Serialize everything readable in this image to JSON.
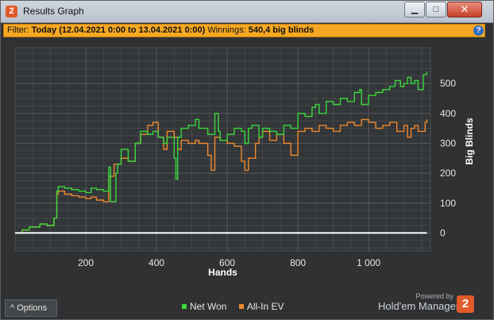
{
  "window": {
    "title": "Results Graph",
    "app_icon_label": "2"
  },
  "filter": {
    "prefix": "Filter:",
    "period": "Today (12.04.2021 0:00 to 13.04.2021 0:00)",
    "winnings_label": "Winnings:",
    "winnings_value": "540,4 big blinds",
    "help_label": "?"
  },
  "chart_data": {
    "type": "line",
    "title": "",
    "xlabel": "Hands",
    "ylabel": "Big Blinds",
    "xlim": [
      0,
      1175
    ],
    "ylim": [
      -60,
      620
    ],
    "x_ticks": [
      200,
      400,
      600,
      800,
      1000
    ],
    "x_tick_labels": [
      "200",
      "400",
      "600",
      "800",
      "1 000"
    ],
    "y_ticks": [
      0,
      100,
      200,
      300,
      400,
      500
    ],
    "y_tick_labels": [
      "0",
      "100",
      "200",
      "300",
      "400",
      "500"
    ],
    "grid": true,
    "legend_position": "bottom",
    "series": [
      {
        "name": "Net Won",
        "color": "#38d93c",
        "x": [
          0,
          20,
          40,
          70,
          90,
          110,
          118,
          122,
          140,
          160,
          180,
          200,
          215,
          230,
          250,
          265,
          270,
          285,
          290,
          300,
          320,
          340,
          355,
          375,
          390,
          405,
          420,
          430,
          450,
          455,
          460,
          470,
          490,
          510,
          520,
          545,
          565,
          575,
          580,
          600,
          620,
          640,
          650,
          660,
          670,
          690,
          700,
          720,
          740,
          760,
          780,
          800,
          820,
          840,
          850,
          860,
          880,
          900,
          920,
          940,
          960,
          975,
          980,
          1000,
          1020,
          1040,
          1060,
          1075,
          1090,
          1100,
          1110,
          1120,
          1130,
          1140,
          1155,
          1165
        ],
        "y": [
          0,
          10,
          20,
          30,
          25,
          50,
          140,
          155,
          150,
          145,
          140,
          135,
          150,
          145,
          140,
          220,
          105,
          200,
          230,
          280,
          240,
          300,
          340,
          330,
          340,
          320,
          300,
          320,
          250,
          180,
          320,
          350,
          360,
          380,
          350,
          330,
          400,
          340,
          310,
          330,
          350,
          340,
          300,
          350,
          360,
          320,
          350,
          340,
          330,
          360,
          350,
          400,
          390,
          420,
          430,
          400,
          440,
          430,
          450,
          440,
          470,
          480,
          430,
          460,
          470,
          480,
          490,
          510,
          490,
          500,
          520,
          500,
          510,
          480,
          530,
          540
        ]
      },
      {
        "name": "All-In EV",
        "color": "#f0892d",
        "x": [
          0,
          20,
          40,
          70,
          90,
          110,
          118,
          122,
          140,
          160,
          180,
          200,
          215,
          230,
          250,
          265,
          280,
          300,
          320,
          340,
          355,
          375,
          390,
          405,
          420,
          430,
          450,
          460,
          470,
          490,
          510,
          520,
          545,
          555,
          565,
          580,
          600,
          620,
          640,
          650,
          660,
          680,
          690,
          700,
          720,
          740,
          760,
          780,
          800,
          820,
          840,
          860,
          880,
          900,
          920,
          940,
          960,
          980,
          1000,
          1020,
          1040,
          1060,
          1080,
          1100,
          1110,
          1120,
          1130,
          1140,
          1160,
          1165
        ],
        "y": [
          0,
          10,
          20,
          30,
          25,
          50,
          130,
          140,
          130,
          125,
          120,
          115,
          120,
          110,
          105,
          190,
          230,
          250,
          240,
          300,
          330,
          360,
          370,
          320,
          280,
          340,
          320,
          280,
          310,
          300,
          310,
          300,
          260,
          210,
          320,
          310,
          300,
          290,
          240,
          210,
          250,
          300,
          320,
          340,
          310,
          330,
          300,
          260,
          340,
          350,
          340,
          360,
          350,
          340,
          360,
          370,
          360,
          380,
          370,
          350,
          360,
          370,
          340,
          360,
          320,
          350,
          360,
          340,
          370,
          380
        ]
      },
      {
        "name": "",
        "color": "#ffffff",
        "x": [
          0,
          1165
        ],
        "y": [
          0,
          0
        ]
      }
    ]
  },
  "bottom": {
    "options_label": "Options",
    "options_chevron": "^",
    "legend": [
      {
        "label": "Net Won",
        "color": "#38d93c"
      },
      {
        "label": "All-In EV",
        "color": "#f0892d"
      }
    ],
    "powered_by": "Powered by",
    "brand": "Hold'em Manager",
    "brand_badge": "2"
  }
}
